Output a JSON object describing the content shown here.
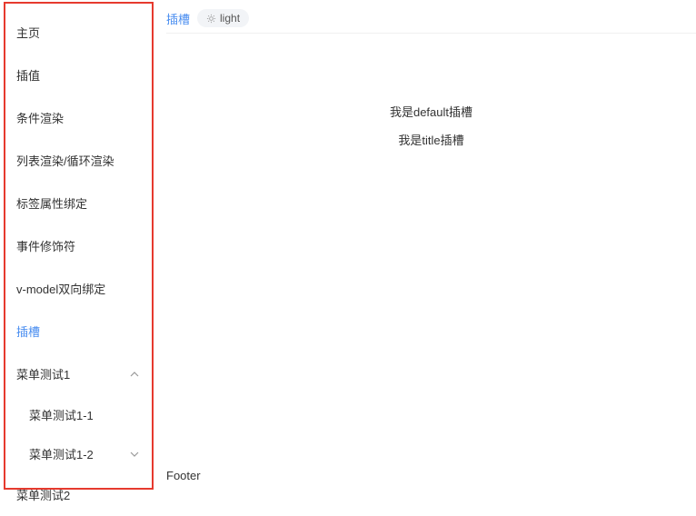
{
  "sidebar": {
    "items": [
      {
        "label": "主页"
      },
      {
        "label": "插值"
      },
      {
        "label": "条件渲染"
      },
      {
        "label": "列表渲染/循环渲染"
      },
      {
        "label": "标签属性绑定"
      },
      {
        "label": "事件修饰符"
      },
      {
        "label": "v-model双向绑定"
      },
      {
        "label": "插槽",
        "active": true
      }
    ],
    "menu_test1": {
      "label": "菜单测试1",
      "children": [
        {
          "label": "菜单测试1-1"
        },
        {
          "label": "菜单测试1-2"
        }
      ]
    },
    "menu_test2": {
      "label": "菜单测试2"
    }
  },
  "topbar": {
    "breadcrumb": "插槽",
    "toggle": "light"
  },
  "content": {
    "line1": "我是default插槽",
    "line2": "我是title插槽"
  },
  "footer": {
    "text": "Footer"
  }
}
